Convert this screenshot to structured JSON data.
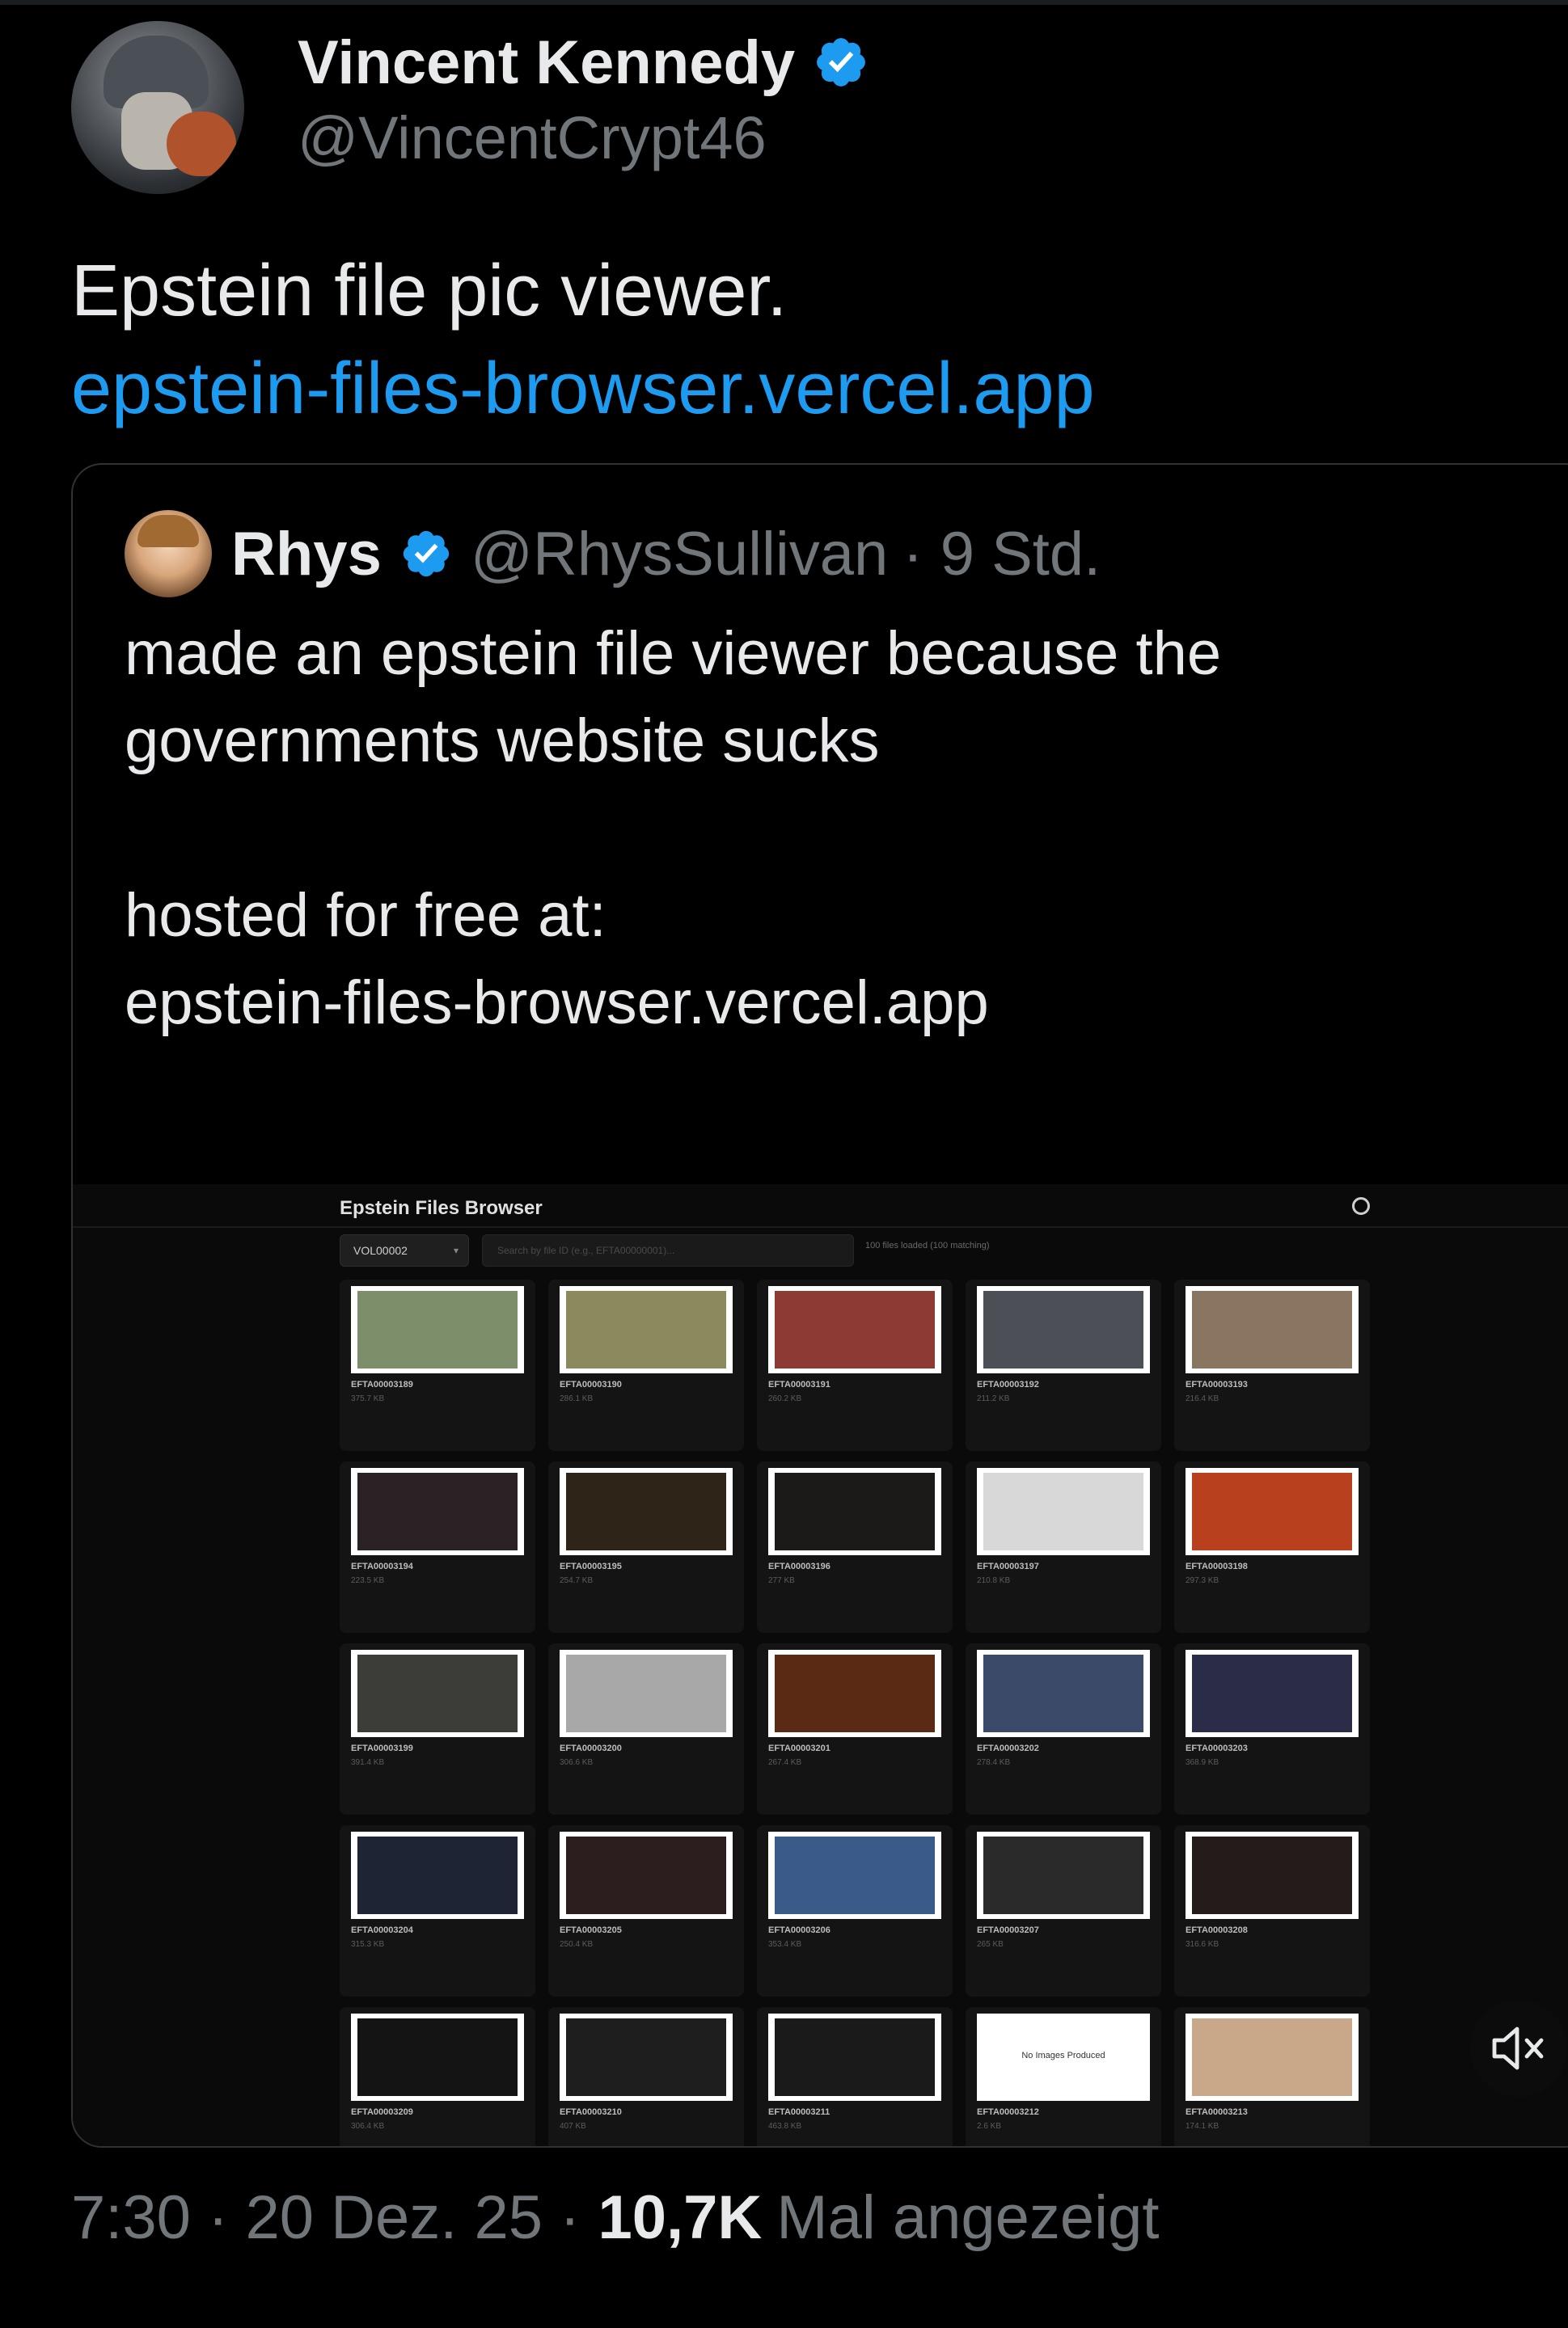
{
  "author": {
    "name": "Vincent Kennedy",
    "handle": "@VincentCrypt46",
    "verified_color": "#1d9bf0"
  },
  "tweet": {
    "text": "Epstein file pic viewer.",
    "link": "epstein-files-browser.vercel.app",
    "link_color": "#1d9bf0"
  },
  "quote": {
    "name": "Rhys",
    "handle": "@RhysSullivan",
    "time": "· 9 Std.",
    "body": {
      "line1": "made an epstein file viewer because the",
      "line2": "governments website sucks",
      "line3": "hosted for free at:",
      "line4": "epstein-files-browser.vercel.app"
    }
  },
  "embedded_app": {
    "title": "Epstein Files Browser",
    "icon": "github-icon",
    "volume": "VOL00002",
    "search_placeholder": "Search by file ID (e.g., EFTA00000001)...",
    "files_count": "100 files loaded (100 matching)",
    "files": [
      {
        "id": "EFTA00003189",
        "size": "375.7 KB",
        "tone": "#7d8f6a"
      },
      {
        "id": "EFTA00003190",
        "size": "286.1 KB",
        "tone": "#8a8a5c"
      },
      {
        "id": "EFTA00003191",
        "size": "260.2 KB",
        "tone": "#8c3a33"
      },
      {
        "id": "EFTA00003192",
        "size": "211.2 KB",
        "tone": "#4c4f55"
      },
      {
        "id": "EFTA00003193",
        "size": "216.4 KB",
        "tone": "#8a7660"
      },
      {
        "id": "EFTA00003194",
        "size": "223.5 KB",
        "tone": "#2a2224"
      },
      {
        "id": "EFTA00003195",
        "size": "254.7 KB",
        "tone": "#2e2418"
      },
      {
        "id": "EFTA00003196",
        "size": "277 KB",
        "tone": "#1c1a18"
      },
      {
        "id": "EFTA00003197",
        "size": "210.8 KB",
        "tone": "#d8d8d8"
      },
      {
        "id": "EFTA00003198",
        "size": "297.3 KB",
        "tone": "#b8401e"
      },
      {
        "id": "EFTA00003199",
        "size": "391.4 KB",
        "tone": "#3c3c38"
      },
      {
        "id": "EFTA00003200",
        "size": "306.6 KB",
        "tone": "#a8a8a8"
      },
      {
        "id": "EFTA00003201",
        "size": "267.4 KB",
        "tone": "#5a2a14"
      },
      {
        "id": "EFTA00003202",
        "size": "278.4 KB",
        "tone": "#3a4a68"
      },
      {
        "id": "EFTA00003203",
        "size": "368.9 KB",
        "tone": "#2a2c48"
      },
      {
        "id": "EFTA00003204",
        "size": "315.3 KB",
        "tone": "#1e2434"
      },
      {
        "id": "EFTA00003205",
        "size": "250.4 KB",
        "tone": "#2c1e1e"
      },
      {
        "id": "EFTA00003206",
        "size": "353.4 KB",
        "tone": "#3a5a8a"
      },
      {
        "id": "EFTA00003207",
        "size": "265 KB",
        "tone": "#2a2a2a"
      },
      {
        "id": "EFTA00003208",
        "size": "316.6 KB",
        "tone": "#231c1a"
      },
      {
        "id": "EFTA00003209",
        "size": "306.4 KB",
        "tone": "#141414"
      },
      {
        "id": "EFTA00003210",
        "size": "407 KB",
        "tone": "#1e1e1e"
      },
      {
        "id": "EFTA00003211",
        "size": "463.8 KB",
        "tone": "#1a1a1a"
      },
      {
        "id": "EFTA00003212",
        "size": "2.6 KB",
        "tone": "#ffffff",
        "no_image": "No Images Produced"
      },
      {
        "id": "EFTA00003213",
        "size": "174.1 KB",
        "tone": "#c8a888"
      }
    ]
  },
  "mute_icon": "speaker-muted-icon",
  "footer": {
    "time": "7:30 · 20 Dez. 25 ·",
    "views": "10,7K",
    "views_label": "Mal angezeigt"
  }
}
